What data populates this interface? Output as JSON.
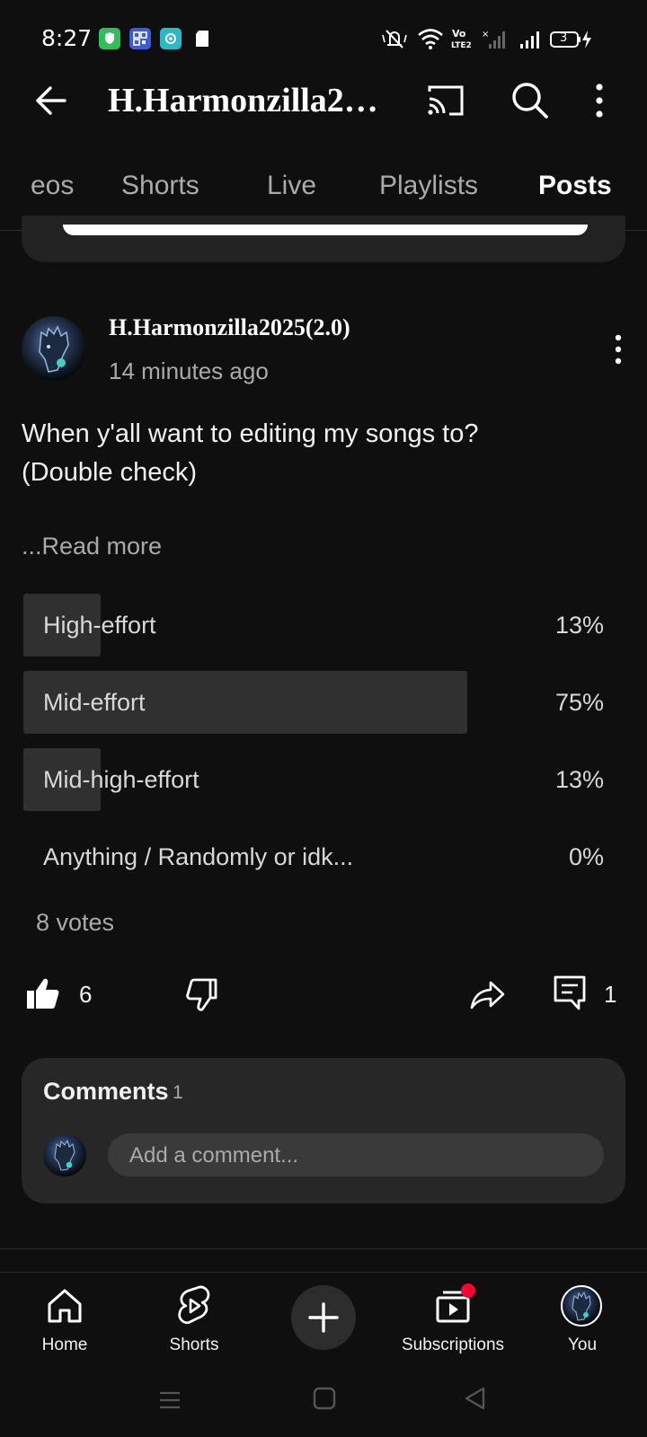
{
  "status_bar": {
    "time": "8:27",
    "battery": "3"
  },
  "header": {
    "channel_title": "H.Harmonzilla2…"
  },
  "tabs": [
    {
      "label": "eos"
    },
    {
      "label": "Shorts"
    },
    {
      "label": "Live"
    },
    {
      "label": "Playlists"
    },
    {
      "label": "Posts"
    }
  ],
  "post": {
    "author": "H.Harmonzilla2025(2.0)",
    "time_ago": "14 minutes ago",
    "text_line1": "When y'all want to editing my songs to?",
    "text_line2": "(Double check)",
    "read_more": "...Read more",
    "poll": {
      "options": [
        {
          "label": "High-effort",
          "percent": "13%",
          "fill": 0.13
        },
        {
          "label": "Mid-effort",
          "percent": "75%",
          "fill": 0.75
        },
        {
          "label": "Mid-high-effort",
          "percent": "13%",
          "fill": 0.13
        },
        {
          "label": "Anything / Randomly or idk...",
          "percent": "0%",
          "fill": 0
        }
      ],
      "votes": "8 votes"
    },
    "actions": {
      "likes": "6",
      "comments": "1"
    }
  },
  "comments": {
    "title": "Comments",
    "count": "1",
    "placeholder": "Add a comment..."
  },
  "bottom_nav": {
    "home": "Home",
    "shorts": "Shorts",
    "subscriptions": "Subscriptions",
    "you": "You"
  },
  "colors": {
    "background": "#0f0f0f",
    "card": "#272727",
    "poll_fill": "#303030",
    "notification_dot": "#ff0033"
  }
}
